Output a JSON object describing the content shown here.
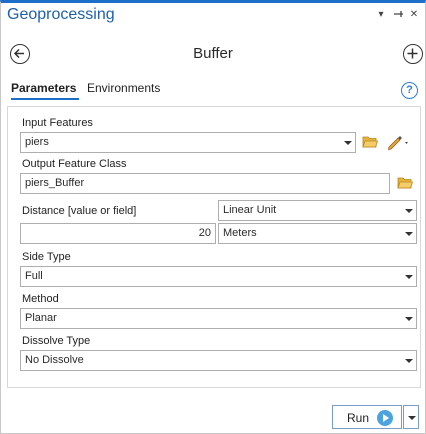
{
  "window": {
    "title": "Geoprocessing",
    "controls": [
      "chevron-down-icon",
      "pin-icon",
      "close-icon"
    ]
  },
  "tool": {
    "title": "Buffer",
    "back_icon": "back-arrow-icon",
    "add_icon": "plus-circle-icon"
  },
  "tabs": [
    {
      "label": "Parameters",
      "active": true
    },
    {
      "label": "Environments",
      "active": false
    }
  ],
  "help_icon": "?",
  "params": {
    "input_features": {
      "label": "Input Features",
      "value": "piers"
    },
    "output_feature_class": {
      "label": "Output Feature Class",
      "value": "piers_Buffer"
    },
    "distance": {
      "label": "Distance [value or field]",
      "type_value": "Linear Unit",
      "value": "20",
      "unit": "Meters"
    },
    "side_type": {
      "label": "Side Type",
      "value": "Full"
    },
    "method": {
      "label": "Method",
      "value": "Planar"
    },
    "dissolve_type": {
      "label": "Dissolve Type",
      "value": "No Dissolve"
    }
  },
  "run": {
    "label": "Run"
  },
  "colors": {
    "accent": "#1d6ec8",
    "folder": "#e8b33b",
    "play": "#4da3e0"
  }
}
